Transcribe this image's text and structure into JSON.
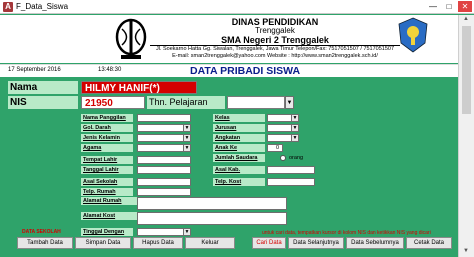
{
  "window": {
    "icon": "A",
    "title": "F_Data_Siswa"
  },
  "header": {
    "line1": "DINAS PENDIDIKAN",
    "line2": "Trenggalek",
    "line3": "SMA Negeri 2 Trenggalek",
    "address": "Jl. Soekarno Hatta Gg. Siwalan, Trenggalek, Jawa Timur Telepon/Fax: 7517051507 / 7517051507",
    "email": "E-mail: sman2trenggalek@yahoo.com   Website : http://www.sman2trenggalek.sch.id/"
  },
  "strip": {
    "date": "17 September 2016",
    "time": "13:48:30",
    "title": "DATA PRIBADI SISWA"
  },
  "form": {
    "nama_label": "Nama",
    "nama_value": "HILMY HANIF(*)",
    "nis_label": "NIS",
    "nis_value": "21950",
    "tahun_label": "Thn. Pelajaran",
    "left_labels": [
      "Nama Panggilan",
      "Gol. Darah",
      "Jenis Kelamin",
      "Agama",
      "Tempat Lahir",
      "Tanggal Lahir",
      "Asal Sekolah",
      "Telp. Rumah",
      "Alamat Rumah",
      "Alamat Kost",
      "Tinggal Dengan"
    ],
    "right_labels": [
      "Kelas",
      "Jurusan",
      "Angkatan",
      "Anak Ke",
      "Jumlah Saudara",
      "Asal Kab.",
      "Telp. Kost"
    ],
    "anak_ke_value": "0",
    "orang_label": "orang"
  },
  "notes": {
    "left": "DATA SEKOLAH",
    "right": "untuk cari data, tempatkan kursor di kolom NIS dan ketikkan NIS yang dicari"
  },
  "buttons": [
    "Tambah Data",
    "Simpan Data",
    "Hapus Data",
    "Keluar",
    "Cari Data",
    "Data Selanjutnya",
    "Data Sebelumnya",
    "Cetak Data"
  ]
}
